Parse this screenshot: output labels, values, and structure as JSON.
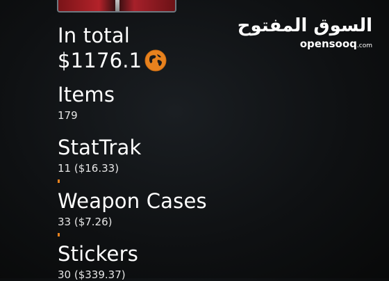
{
  "logo": {
    "arabic": "السوق المفتوح",
    "english": "opensooq",
    "domain": ".com"
  },
  "total": {
    "label": "In total",
    "value": "$1176.1",
    "icon": "globe-icon",
    "icon_color": "#e8821e"
  },
  "stats": [
    {
      "title": "Items",
      "value": "179"
    },
    {
      "title": "StatTrak",
      "value": "11 ($16.33)"
    },
    {
      "title": "Weapon Cases",
      "value": "33 ($7.26)"
    },
    {
      "title": "Stickers",
      "value": "30 ($339.37)"
    }
  ],
  "accent_color": "#e8821e"
}
